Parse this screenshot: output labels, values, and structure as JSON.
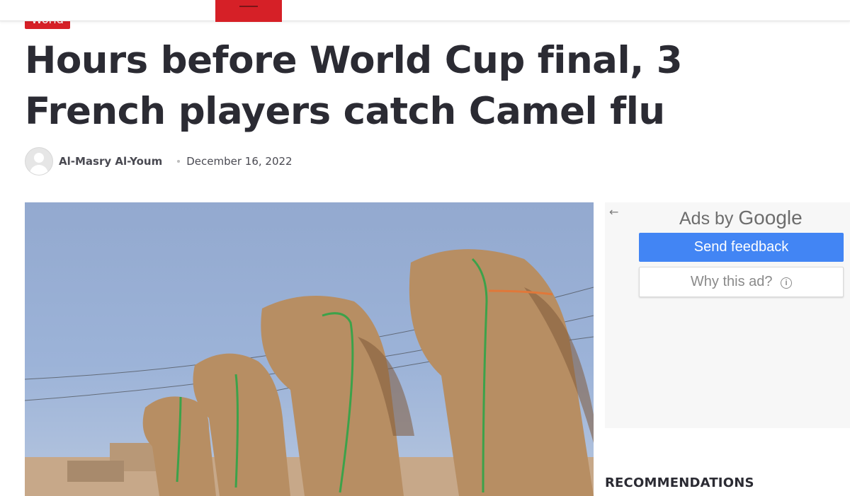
{
  "header": {
    "menu_icon": "hamburger-menu-icon",
    "accent": "#d62027"
  },
  "article": {
    "category": "World",
    "title": "Hours before World Cup final, 3 French players catch Camel flu",
    "author": "Al-Masry Al-Youm",
    "date": "December 16, 2022",
    "image_alt_icon": "camels-photo"
  },
  "ad": {
    "back_icon": "arrow-left-icon",
    "ads_by_prefix": "Ads by",
    "ads_by_brand": "Google",
    "send_feedback": "Send feedback",
    "why_this_ad": "Why this ad?",
    "button_color": "#4285f4"
  },
  "sidebar": {
    "recommendations_heading": "RECOMMENDATIONS"
  }
}
